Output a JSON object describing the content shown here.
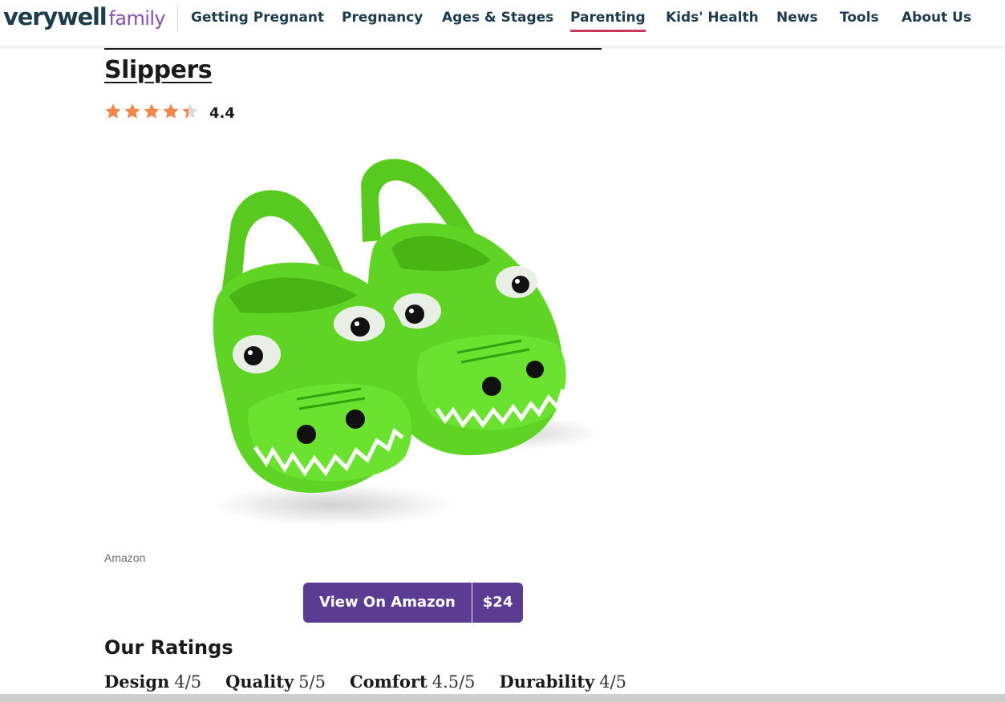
{
  "header": {
    "logo_main": "verywell",
    "logo_sub": "family",
    "nav": [
      {
        "label": "Getting Pregnant",
        "active": false
      },
      {
        "label": "Pregnancy",
        "active": false
      },
      {
        "label": "Ages & Stages",
        "active": false
      },
      {
        "label": "Parenting",
        "active": true
      },
      {
        "label": "Kids' Health",
        "active": false
      },
      {
        "label": "News",
        "active": false
      },
      {
        "label": "Tools",
        "active": false
      },
      {
        "label": "About Us",
        "active": false
      }
    ]
  },
  "product": {
    "title": "Slippers",
    "rating_value": "4.4",
    "star_rating": 4.4,
    "star_max": 5,
    "image_alt": "Green dinosaur slippers",
    "image_credit": "Amazon",
    "buy_label": "View On Amazon",
    "price": "$24"
  },
  "our_ratings": {
    "heading": "Our Ratings",
    "items": [
      {
        "label": "Design",
        "value": "4/5"
      },
      {
        "label": "Quality",
        "value": "5/5"
      },
      {
        "label": "Comfort",
        "value": "4.5/5"
      },
      {
        "label": "Durability",
        "value": "4/5"
      }
    ]
  },
  "colors": {
    "brand_navy": "#1c3d4c",
    "brand_purple": "#8a4db0",
    "nav_active_underline": "#c8385a",
    "star_orange": "#f0884a",
    "star_empty": "#d9d9d9",
    "button_purple": "#5c3c92"
  }
}
